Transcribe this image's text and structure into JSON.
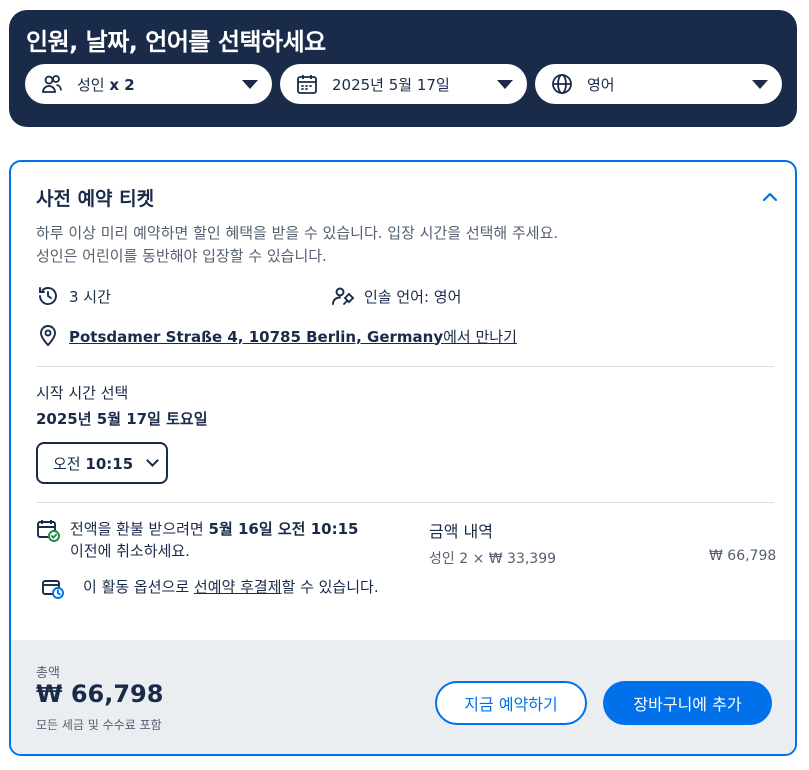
{
  "header": {
    "title": "인원, 날짜, 언어를 선택하세요",
    "participants": {
      "prefix": "성인",
      "value": "x 2"
    },
    "date": "2025년 5월 17일",
    "language": "영어"
  },
  "card": {
    "title": "사전 예약 티켓",
    "description": "하루 이상 미리 예약하면 할인 혜택을 받을 수 있습니다. 입장 시간을 선택해 주세요. 성인은 어린이를 동반해야 입장할 수 있습니다.",
    "duration": "3 시간",
    "guide_language": "인솔 언어: 영어",
    "meeting": {
      "address": "Potsdamer Straße 4, 10785 Berlin, Germany",
      "suffix": "에서 만나기"
    },
    "start_time_label": "시작 시간 선택",
    "selected_date": "2025년 5월 17일 토요일",
    "time_select": {
      "prefix": "오전",
      "value": "10:15"
    },
    "refund_note": {
      "part1": "전액을 환불 받으려면",
      "bold": "5월 16일 오전 10:15",
      "part2": "이전에 취소하세요."
    },
    "reserve_note": {
      "part1": "이 활동 옵션으로",
      "link": "선예약 후결제",
      "part2": "할 수 있습니다."
    },
    "price": {
      "title": "금액 내역",
      "line_label": "성인 2 × ₩ 33,399",
      "line_total": "₩ 66,798"
    }
  },
  "footer": {
    "label": "총액",
    "total": "₩ 66,798",
    "note": "모든 세금 및 수수료 포함",
    "book_now": "지금 예약하기",
    "add_to_cart": "장바구니에 추가"
  },
  "colors": {
    "navy": "#1a2b49",
    "accent": "#0071eb",
    "muted": "#545f71",
    "footer_bg": "#ebeef1"
  },
  "icons": [
    "people-icon",
    "calendar-icon",
    "globe-icon",
    "chevron-up-icon",
    "clock-history-icon",
    "guide-icon",
    "location-pin-icon",
    "calendar-check-icon",
    "wallet-clock-icon"
  ]
}
